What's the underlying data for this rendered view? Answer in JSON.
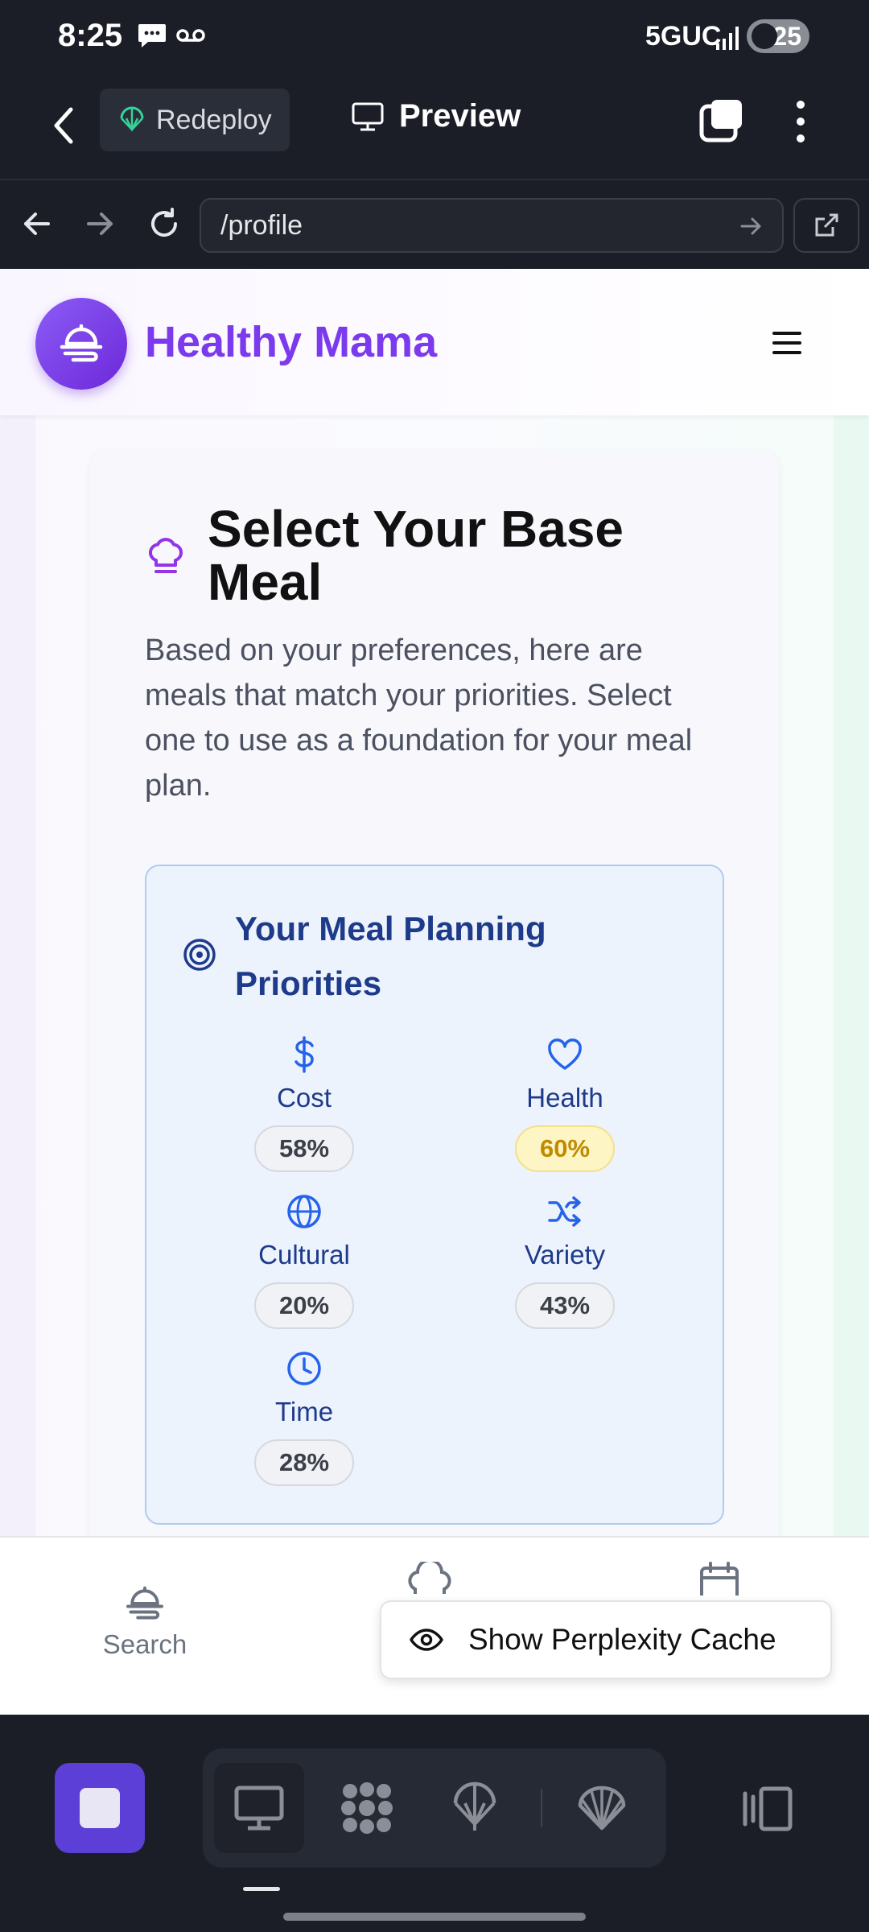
{
  "status_bar": {
    "time": "8:25",
    "network": "5GUC",
    "battery": "25"
  },
  "toolbar": {
    "redeploy_label": "Redeploy",
    "preview_label": "Preview"
  },
  "url_bar": {
    "value": "/profile"
  },
  "site": {
    "brand": "Healthy Mama"
  },
  "card": {
    "title": "Select Your Base Meal",
    "description": "Based on your preferences, here are meals that match your priorities. Select one to use as a foundation for your meal plan.",
    "priorities": {
      "title": "Your Meal Planning Priorities",
      "items": [
        {
          "label": "Cost",
          "value": "58%",
          "icon": "dollar-icon"
        },
        {
          "label": "Health",
          "value": "60%",
          "icon": "heart-icon",
          "highlight": true
        },
        {
          "label": "Cultural",
          "value": "20%",
          "icon": "globe-icon"
        },
        {
          "label": "Variety",
          "value": "43%",
          "icon": "shuffle-icon"
        },
        {
          "label": "Time",
          "value": "28%",
          "icon": "clock-icon"
        }
      ]
    }
  },
  "bottom_nav": {
    "search_label": "Search"
  },
  "perplexity": {
    "label": "Show Perplexity Cache"
  },
  "colors": {
    "brand": "#7c3aed",
    "accent_blue": "#1e3a8a",
    "highlight_pill": "#fdf5c4",
    "dock_stop": "#5b3fd6"
  }
}
